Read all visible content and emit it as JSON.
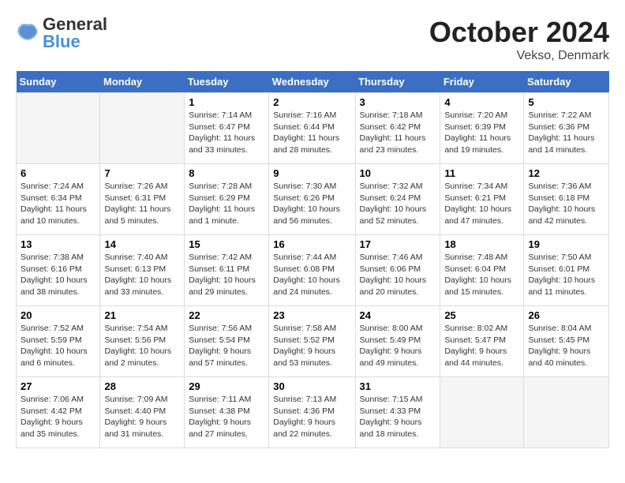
{
  "logo": {
    "line1": "General",
    "line2": "Blue"
  },
  "title": "October 2024",
  "subtitle": "Vekso, Denmark",
  "weekdays": [
    "Sunday",
    "Monday",
    "Tuesday",
    "Wednesday",
    "Thursday",
    "Friday",
    "Saturday"
  ],
  "weeks": [
    [
      {
        "day": "",
        "empty": true
      },
      {
        "day": "",
        "empty": true
      },
      {
        "day": "1",
        "sunrise": "Sunrise: 7:14 AM",
        "sunset": "Sunset: 6:47 PM",
        "daylight": "Daylight: 11 hours and 33 minutes."
      },
      {
        "day": "2",
        "sunrise": "Sunrise: 7:16 AM",
        "sunset": "Sunset: 6:44 PM",
        "daylight": "Daylight: 11 hours and 28 minutes."
      },
      {
        "day": "3",
        "sunrise": "Sunrise: 7:18 AM",
        "sunset": "Sunset: 6:42 PM",
        "daylight": "Daylight: 11 hours and 23 minutes."
      },
      {
        "day": "4",
        "sunrise": "Sunrise: 7:20 AM",
        "sunset": "Sunset: 6:39 PM",
        "daylight": "Daylight: 11 hours and 19 minutes."
      },
      {
        "day": "5",
        "sunrise": "Sunrise: 7:22 AM",
        "sunset": "Sunset: 6:36 PM",
        "daylight": "Daylight: 11 hours and 14 minutes."
      }
    ],
    [
      {
        "day": "6",
        "sunrise": "Sunrise: 7:24 AM",
        "sunset": "Sunset: 6:34 PM",
        "daylight": "Daylight: 11 hours and 10 minutes."
      },
      {
        "day": "7",
        "sunrise": "Sunrise: 7:26 AM",
        "sunset": "Sunset: 6:31 PM",
        "daylight": "Daylight: 11 hours and 5 minutes."
      },
      {
        "day": "8",
        "sunrise": "Sunrise: 7:28 AM",
        "sunset": "Sunset: 6:29 PM",
        "daylight": "Daylight: 11 hours and 1 minute."
      },
      {
        "day": "9",
        "sunrise": "Sunrise: 7:30 AM",
        "sunset": "Sunset: 6:26 PM",
        "daylight": "Daylight: 10 hours and 56 minutes."
      },
      {
        "day": "10",
        "sunrise": "Sunrise: 7:32 AM",
        "sunset": "Sunset: 6:24 PM",
        "daylight": "Daylight: 10 hours and 52 minutes."
      },
      {
        "day": "11",
        "sunrise": "Sunrise: 7:34 AM",
        "sunset": "Sunset: 6:21 PM",
        "daylight": "Daylight: 10 hours and 47 minutes."
      },
      {
        "day": "12",
        "sunrise": "Sunrise: 7:36 AM",
        "sunset": "Sunset: 6:18 PM",
        "daylight": "Daylight: 10 hours and 42 minutes."
      }
    ],
    [
      {
        "day": "13",
        "sunrise": "Sunrise: 7:38 AM",
        "sunset": "Sunset: 6:16 PM",
        "daylight": "Daylight: 10 hours and 38 minutes."
      },
      {
        "day": "14",
        "sunrise": "Sunrise: 7:40 AM",
        "sunset": "Sunset: 6:13 PM",
        "daylight": "Daylight: 10 hours and 33 minutes."
      },
      {
        "day": "15",
        "sunrise": "Sunrise: 7:42 AM",
        "sunset": "Sunset: 6:11 PM",
        "daylight": "Daylight: 10 hours and 29 minutes."
      },
      {
        "day": "16",
        "sunrise": "Sunrise: 7:44 AM",
        "sunset": "Sunset: 6:08 PM",
        "daylight": "Daylight: 10 hours and 24 minutes."
      },
      {
        "day": "17",
        "sunrise": "Sunrise: 7:46 AM",
        "sunset": "Sunset: 6:06 PM",
        "daylight": "Daylight: 10 hours and 20 minutes."
      },
      {
        "day": "18",
        "sunrise": "Sunrise: 7:48 AM",
        "sunset": "Sunset: 6:04 PM",
        "daylight": "Daylight: 10 hours and 15 minutes."
      },
      {
        "day": "19",
        "sunrise": "Sunrise: 7:50 AM",
        "sunset": "Sunset: 6:01 PM",
        "daylight": "Daylight: 10 hours and 11 minutes."
      }
    ],
    [
      {
        "day": "20",
        "sunrise": "Sunrise: 7:52 AM",
        "sunset": "Sunset: 5:59 PM",
        "daylight": "Daylight: 10 hours and 6 minutes."
      },
      {
        "day": "21",
        "sunrise": "Sunrise: 7:54 AM",
        "sunset": "Sunset: 5:56 PM",
        "daylight": "Daylight: 10 hours and 2 minutes."
      },
      {
        "day": "22",
        "sunrise": "Sunrise: 7:56 AM",
        "sunset": "Sunset: 5:54 PM",
        "daylight": "Daylight: 9 hours and 57 minutes."
      },
      {
        "day": "23",
        "sunrise": "Sunrise: 7:58 AM",
        "sunset": "Sunset: 5:52 PM",
        "daylight": "Daylight: 9 hours and 53 minutes."
      },
      {
        "day": "24",
        "sunrise": "Sunrise: 8:00 AM",
        "sunset": "Sunset: 5:49 PM",
        "daylight": "Daylight: 9 hours and 49 minutes."
      },
      {
        "day": "25",
        "sunrise": "Sunrise: 8:02 AM",
        "sunset": "Sunset: 5:47 PM",
        "daylight": "Daylight: 9 hours and 44 minutes."
      },
      {
        "day": "26",
        "sunrise": "Sunrise: 8:04 AM",
        "sunset": "Sunset: 5:45 PM",
        "daylight": "Daylight: 9 hours and 40 minutes."
      }
    ],
    [
      {
        "day": "27",
        "sunrise": "Sunrise: 7:06 AM",
        "sunset": "Sunset: 4:42 PM",
        "daylight": "Daylight: 9 hours and 35 minutes."
      },
      {
        "day": "28",
        "sunrise": "Sunrise: 7:09 AM",
        "sunset": "Sunset: 4:40 PM",
        "daylight": "Daylight: 9 hours and 31 minutes."
      },
      {
        "day": "29",
        "sunrise": "Sunrise: 7:11 AM",
        "sunset": "Sunset: 4:38 PM",
        "daylight": "Daylight: 9 hours and 27 minutes."
      },
      {
        "day": "30",
        "sunrise": "Sunrise: 7:13 AM",
        "sunset": "Sunset: 4:36 PM",
        "daylight": "Daylight: 9 hours and 22 minutes."
      },
      {
        "day": "31",
        "sunrise": "Sunrise: 7:15 AM",
        "sunset": "Sunset: 4:33 PM",
        "daylight": "Daylight: 9 hours and 18 minutes."
      },
      {
        "day": "",
        "empty": true
      },
      {
        "day": "",
        "empty": true
      }
    ]
  ]
}
